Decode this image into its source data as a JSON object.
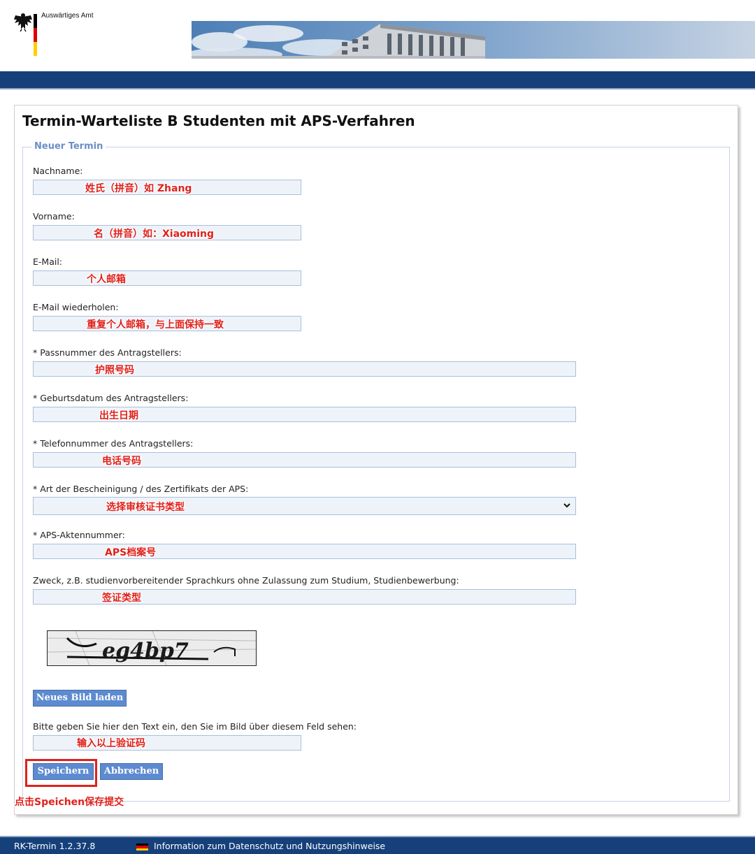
{
  "header": {
    "org_name": "Auswärtiges Amt"
  },
  "page": {
    "title": "Termin-Warteliste B Studenten mit APS-Verfahren"
  },
  "form": {
    "legend": "Neuer Termin",
    "fields": [
      {
        "label": "Nachname:",
        "annotation": "姓氏（拼音）如 Zhang"
      },
      {
        "label": "Vorname:",
        "annotation": "名（拼音）如：Xiaoming"
      },
      {
        "label": "E-Mail:",
        "annotation": "个人邮箱"
      },
      {
        "label": "E-Mail wiederholen:",
        "annotation": "重复个人邮箱，与上面保持一致"
      },
      {
        "label": "* Passnummer des Antragstellers:",
        "annotation": "护照号码"
      },
      {
        "label": "* Geburtsdatum des Antragstellers:",
        "annotation": "出生日期"
      },
      {
        "label": "* Telefonnummer des Antragstellers:",
        "annotation": "电话号码"
      },
      {
        "label": "* Art der Bescheinigung / des Zertifikats der APS:",
        "annotation": "选择审核证书类型"
      },
      {
        "label": "* APS-Aktennummer:",
        "annotation": "APS档案号"
      },
      {
        "label": "Zweck, z.B. studienvorbereitender Sprachkurs ohne Zulassung zum Studium, Studienbewerbung:",
        "annotation": "签证类型"
      }
    ],
    "captcha": {
      "image_text": "eg4bp7",
      "reload_button": "Neues Bild laden",
      "label": "Bitte geben Sie hier den Text ein, den Sie im Bild über diesem Feld sehen:",
      "annotation": "输入以上验证码"
    },
    "save_button": "Speichern",
    "cancel_button": "Abbrechen",
    "save_annotation": "点击Speichen保存提交"
  },
  "footer": {
    "version": "RK-Termin 1.2.37.8",
    "info_link": "Information zum Datenschutz und Nutzungshinweise"
  },
  "colors": {
    "navbar": "#16407a",
    "button": "#5d8bd0",
    "annotation_red": "#e0211b",
    "input_bg": "#eef3fa"
  },
  "icons": [
    "eagle-icon",
    "chevron-down-icon",
    "german-flag-icon"
  ]
}
